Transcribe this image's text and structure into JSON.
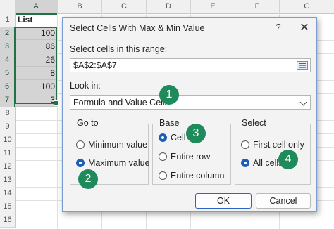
{
  "sheet": {
    "columns": [
      "A",
      "B",
      "C",
      "D",
      "E",
      "F",
      "G"
    ],
    "rows": [
      "1",
      "2",
      "3",
      "4",
      "5",
      "6",
      "7",
      "8",
      "9",
      "10",
      "11",
      "12",
      "13",
      "14",
      "15",
      "16"
    ],
    "header_cell": "List",
    "values": [
      "100",
      "86",
      "26",
      "8",
      "100",
      "3"
    ]
  },
  "dialog": {
    "title": "Select Cells With Max & Min Value",
    "help": "?",
    "close": "✕",
    "range_label": "Select cells in this range:",
    "range_value": "$A$2:$A$7",
    "look_in_label": "Look in:",
    "look_in_value": "Formula and Value Cells",
    "goto": {
      "title": "Go to",
      "options": [
        "Minimum value",
        "Maximum value"
      ],
      "selected": 1
    },
    "base": {
      "title": "Base",
      "options": [
        "Cell",
        "Entire row",
        "Entire column"
      ],
      "selected": 0
    },
    "select": {
      "title": "Select",
      "options": [
        "First cell only",
        "All cells"
      ],
      "selected": 1
    },
    "ok": "OK",
    "cancel": "Cancel"
  },
  "badges": [
    "1",
    "2",
    "3",
    "4"
  ],
  "colors": {
    "accent": "#217346",
    "badge": "#1f8a5a",
    "radio": "#1a5fb4"
  }
}
